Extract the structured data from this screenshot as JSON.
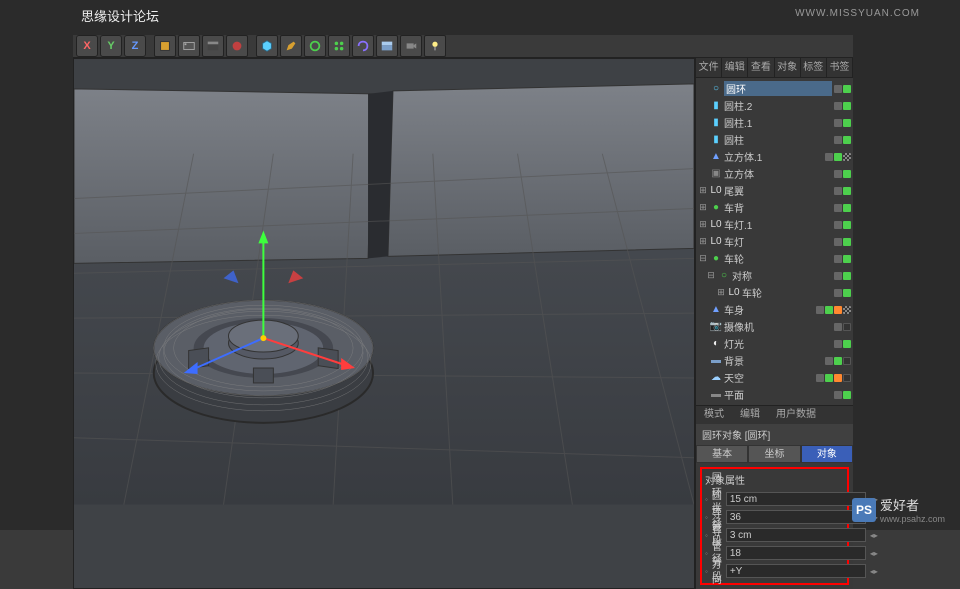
{
  "watermarks": {
    "top_text": "思缘设计论坛",
    "top_url": "WWW.MISSYUAN.COM",
    "bottom_cn": "爱好者",
    "bottom_url": "www.psahz.com",
    "bottom_logo": "PS"
  },
  "viewport": {
    "corner_icons": "✦ ⊞ ⊡"
  },
  "toolbar": {
    "x": "X",
    "y": "Y",
    "z": "Z"
  },
  "panel_tabs": [
    "文件",
    "编辑",
    "查看",
    "对象",
    "标签",
    "书签"
  ],
  "objects": [
    {
      "d": 0,
      "exp": "",
      "icon": "○",
      "ic": "#5bd0ff",
      "name": "圆环",
      "sel": true,
      "dots": [
        "g",
        "c"
      ]
    },
    {
      "d": 0,
      "exp": "",
      "icon": "▮",
      "ic": "#5bd0ff",
      "name": "圆柱.2",
      "dots": [
        "g",
        "c"
      ]
    },
    {
      "d": 0,
      "exp": "",
      "icon": "▮",
      "ic": "#5bd0ff",
      "name": "圆柱.1",
      "dots": [
        "g",
        "c"
      ]
    },
    {
      "d": 0,
      "exp": "",
      "icon": "▮",
      "ic": "#5bd0ff",
      "name": "圆柱",
      "dots": [
        "g",
        "c"
      ]
    },
    {
      "d": 0,
      "exp": "",
      "icon": "▲",
      "ic": "#70a0ff",
      "name": "立方体.1",
      "dots": [
        "g",
        "c",
        "chk"
      ]
    },
    {
      "d": 0,
      "exp": "",
      "icon": "▣",
      "ic": "#888",
      "name": "立方体",
      "dots": [
        "g",
        "c"
      ]
    },
    {
      "d": 0,
      "exp": "⊞",
      "icon": "L0",
      "ic": "#ddd",
      "name": "尾翼",
      "dots": [
        "g",
        "c"
      ]
    },
    {
      "d": 0,
      "exp": "⊞",
      "icon": "●",
      "ic": "#4dd04d",
      "name": "车背",
      "dots": [
        "g",
        "c"
      ]
    },
    {
      "d": 0,
      "exp": "⊞",
      "icon": "L0",
      "ic": "#ddd",
      "name": "车灯.1",
      "dots": [
        "g",
        "c"
      ]
    },
    {
      "d": 0,
      "exp": "⊞",
      "icon": "L0",
      "ic": "#ddd",
      "name": "车灯",
      "dots": [
        "g",
        "c"
      ]
    },
    {
      "d": 0,
      "exp": "⊟",
      "icon": "●",
      "ic": "#4dd04d",
      "name": "车轮",
      "dots": [
        "g",
        "c"
      ]
    },
    {
      "d": 1,
      "exp": "⊟",
      "icon": "○",
      "ic": "#4dd04d",
      "name": "对称",
      "dots": [
        "g",
        "c"
      ]
    },
    {
      "d": 2,
      "exp": "⊞",
      "icon": "L0",
      "ic": "#ddd",
      "name": "车轮",
      "dots": [
        "g",
        "c"
      ]
    },
    {
      "d": 0,
      "exp": "",
      "icon": "▲",
      "ic": "#70a0ff",
      "name": "车身",
      "dots": [
        "g",
        "c",
        "x",
        "chk"
      ]
    },
    {
      "d": 0,
      "exp": "",
      "icon": "📷",
      "ic": "#ddd",
      "name": "摄像机",
      "dots": [
        "g",
        "dk"
      ]
    },
    {
      "d": 0,
      "exp": "",
      "icon": "◐",
      "ic": "#eee",
      "name": "灯光",
      "dots": [
        "g",
        "c"
      ]
    },
    {
      "d": 0,
      "exp": "",
      "icon": "▬",
      "ic": "#7b9fc9",
      "name": "背景",
      "dots": [
        "g",
        "c",
        "dk"
      ]
    },
    {
      "d": 0,
      "exp": "",
      "icon": "☁",
      "ic": "#9bd0ff",
      "name": "天空",
      "dots": [
        "g",
        "c",
        "x",
        "dk"
      ]
    },
    {
      "d": 0,
      "exp": "",
      "icon": "▬",
      "ic": "#888",
      "name": "平面",
      "dots": [
        "g",
        "c"
      ]
    }
  ],
  "attr": {
    "mode_tabs": [
      "模式",
      "编辑",
      "用户数据"
    ],
    "header": "圆环对象 [圆环]",
    "subtabs": [
      "基本",
      "坐标",
      "对象"
    ],
    "section_title": "对象属性",
    "rows": [
      {
        "label": "圆环半径",
        "value": "15 cm"
      },
      {
        "label": "圆环分段",
        "value": "36"
      },
      {
        "label": "导管半径",
        "value": "3 cm"
      },
      {
        "label": "导管分段",
        "value": "18"
      },
      {
        "label": "方向",
        "value": "+Y"
      }
    ]
  }
}
